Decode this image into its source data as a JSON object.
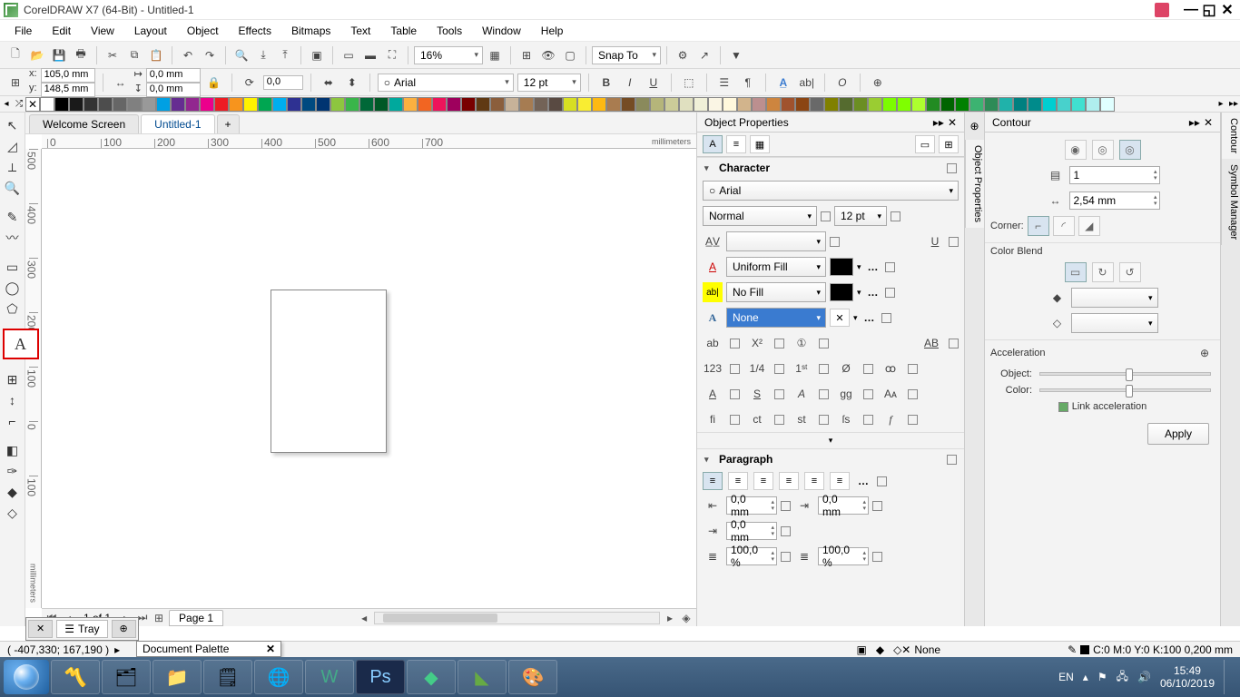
{
  "title": "CorelDRAW X7 (64-Bit) - Untitled-1",
  "menus": [
    "File",
    "Edit",
    "View",
    "Layout",
    "Object",
    "Effects",
    "Bitmaps",
    "Text",
    "Table",
    "Tools",
    "Window",
    "Help"
  ],
  "toolbar1": {
    "zoom": "16%",
    "snap_to": "Snap To"
  },
  "propertybar": {
    "x_label": "x:",
    "x_val": "105,0 mm",
    "y_label": "y:",
    "y_val": "148,5 mm",
    "w_val": "0,0 mm",
    "h_val": "0,0 mm",
    "angle": "0,0",
    "font": "Arial",
    "font_icon": "○",
    "size": "12 pt"
  },
  "tabs": {
    "welcome": "Welcome Screen",
    "doc": "Untitled-1"
  },
  "ruler_h": [
    "0",
    "100",
    "200",
    "300",
    "400",
    "500",
    "600",
    "700"
  ],
  "ruler_unit": "millimeters",
  "ruler_v": [
    "500",
    "400",
    "300",
    "200",
    "100",
    "0",
    "100"
  ],
  "pagebar": {
    "counter": "1 of 1",
    "page": "Page 1"
  },
  "tray": "Tray",
  "status": {
    "coords": "( -407,330; 167,190 )",
    "fill": "None",
    "outline": "C:0 M:0 Y:0 K:100 0,200 mm"
  },
  "doc_palette": "Document Palette",
  "object_properties": {
    "title": "Object Properties",
    "character": "Character",
    "font": "Arial",
    "style": "Normal",
    "size": "12 pt",
    "fill_type": "Uniform Fill",
    "bg_fill": "No Fill",
    "outline": "None",
    "paragraph": "Paragraph",
    "indent1": "0,0 mm",
    "indent2": "0,0 mm",
    "indent3": "0,0 mm",
    "spacing1": "100,0 %",
    "spacing2": "100,0 %"
  },
  "contour": {
    "title": "Contour",
    "steps": "1",
    "offset": "2,54 mm",
    "corner": "Corner:",
    "blend": "Color Blend",
    "accel": "Acceleration",
    "obj": "Object:",
    "col": "Color:",
    "link": "Link acceleration",
    "apply": "Apply"
  },
  "vtabs": [
    "Object Properties",
    "Contour",
    "Symbol Manager"
  ],
  "taskbar": {
    "lang": "EN",
    "time": "15:49",
    "date": "06/10/2019"
  },
  "palette_colors": [
    "#ffffff",
    "#000000",
    "#1a1a1a",
    "#333333",
    "#4d4d4d",
    "#666666",
    "#808080",
    "#999999",
    "#00a0e3",
    "#662d91",
    "#92278f",
    "#ec008c",
    "#ed1c24",
    "#f7941d",
    "#fff200",
    "#00a651",
    "#00aeef",
    "#2e3192",
    "#004a80",
    "#003471",
    "#8dc63f",
    "#39b54a",
    "#006838",
    "#005826",
    "#00a99d",
    "#fbb040",
    "#f26522",
    "#ed145b",
    "#9e005d",
    "#790000",
    "#603913",
    "#8b5e3c",
    "#c7b299",
    "#a67c52",
    "#736357",
    "#594a42",
    "#d7df23",
    "#f9ed32",
    "#fdb913",
    "#a97c50",
    "#754c24",
    "#8a8a5c",
    "#b5b57a",
    "#cccc99",
    "#e0e0c0",
    "#f0f0d8",
    "#faf5e4",
    "#fff8dc",
    "#d2b48c",
    "#bc8f8f",
    "#cd853f",
    "#a0522d",
    "#8b4513",
    "#696969",
    "#808000",
    "#556b2f",
    "#6b8e23",
    "#9acd32",
    "#7cfc00",
    "#7fff00",
    "#adff2f",
    "#228b22",
    "#006400",
    "#008000",
    "#3cb371",
    "#2e8b57",
    "#20b2aa",
    "#008080",
    "#008b8b",
    "#00ced1",
    "#48d1cc",
    "#40e0d0",
    "#afeeee",
    "#e0ffff"
  ]
}
